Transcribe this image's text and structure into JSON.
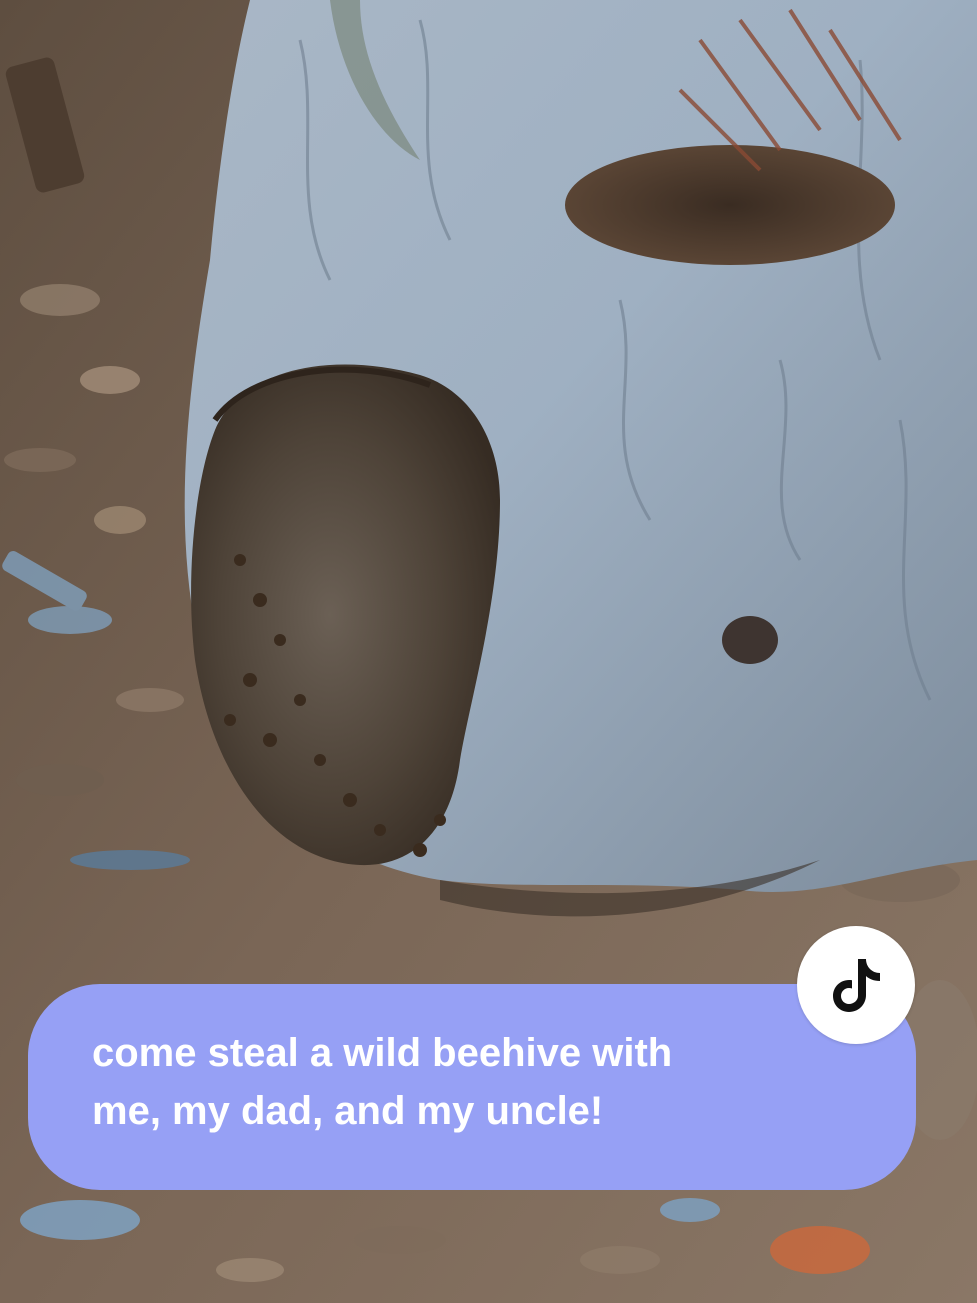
{
  "caption": {
    "text": "come steal a wild beehive with\nme, my dad, and my uncle!"
  },
  "badge": {
    "icon": "tiktok-logo-icon"
  },
  "colors": {
    "caption_bg": "#96a0f5",
    "caption_text": "#ffffff",
    "badge_bg": "#ffffff",
    "logo": "#111111"
  }
}
